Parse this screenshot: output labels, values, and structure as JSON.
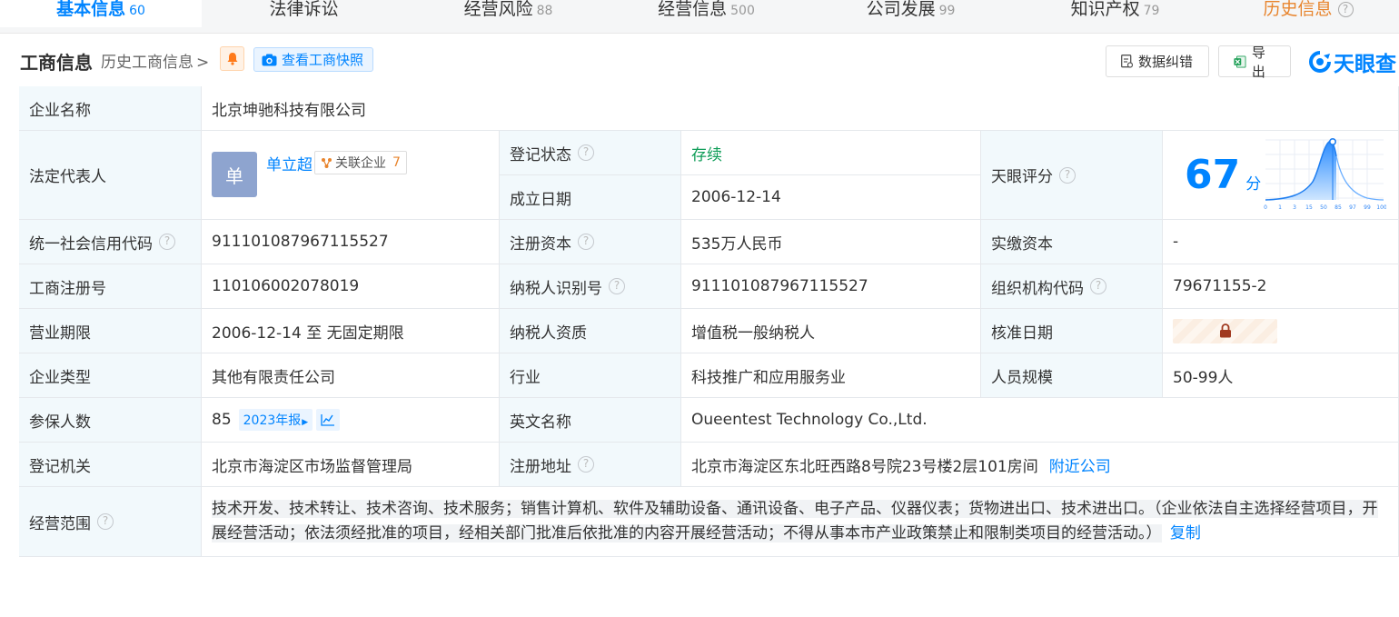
{
  "tabs": [
    {
      "label": "基本信息",
      "count": "60"
    },
    {
      "label": "法律诉讼",
      "count": ""
    },
    {
      "label": "经营风险",
      "count": "88"
    },
    {
      "label": "经营信息",
      "count": "500"
    },
    {
      "label": "公司发展",
      "count": "99"
    },
    {
      "label": "知识产权",
      "count": "79"
    },
    {
      "label": "历史信息",
      "count": ""
    }
  ],
  "header": {
    "title": "工商信息",
    "history_link": "历史工商信息",
    "snapshot_btn": "查看工商快照",
    "correct_btn": "数据纠错",
    "export_btn": "导出",
    "logo_text": "天眼查"
  },
  "rows": {
    "company_name": {
      "label": "企业名称",
      "value": "北京坤驰科技有限公司"
    },
    "legal_rep": {
      "label": "法定代表人",
      "avatar": "单",
      "name": "单立超",
      "related_label": "关联企业",
      "related_count": "7"
    },
    "reg_status": {
      "label": "登记状态",
      "value": "存续"
    },
    "found_date": {
      "label": "成立日期",
      "value": "2006-12-14"
    },
    "tianyan_score": {
      "label": "天眼评分",
      "value": "67",
      "unit": "分",
      "axis": [
        "0",
        "1",
        "3",
        "15",
        "50",
        "85",
        "97",
        "99",
        "100"
      ]
    },
    "credit_code": {
      "label": "统一社会信用代码",
      "value": "911101087967115527"
    },
    "reg_capital": {
      "label": "注册资本",
      "value": "535万人民币"
    },
    "paid_capital": {
      "label": "实缴资本",
      "value": "-"
    },
    "reg_no": {
      "label": "工商注册号",
      "value": "110106002078019"
    },
    "taxpayer_id": {
      "label": "纳税人识别号",
      "value": "911101087967115527"
    },
    "org_code": {
      "label": "组织机构代码",
      "value": "79671155-2"
    },
    "biz_term": {
      "label": "营业期限",
      "value": "2006-12-14 至 无固定期限"
    },
    "tax_quality": {
      "label": "纳税人资质",
      "value": "增值税一般纳税人"
    },
    "approve_date": {
      "label": "核准日期"
    },
    "company_type": {
      "label": "企业类型",
      "value": "其他有限责任公司"
    },
    "industry": {
      "label": "行业",
      "value": "科技推广和应用服务业"
    },
    "staff_size": {
      "label": "人员规模",
      "value": "50-99人"
    },
    "insured": {
      "label": "参保人数",
      "value": "85",
      "report": "2023年报"
    },
    "english_name": {
      "label": "英文名称",
      "value": "Oueentest Technology Co.,Ltd."
    },
    "reg_authority": {
      "label": "登记机关",
      "value": "北京市海淀区市场监督管理局"
    },
    "reg_address": {
      "label": "注册地址",
      "value": "北京市海淀区东北旺西路8号院23号楼2层101房间",
      "nearby": "附近公司"
    },
    "biz_scope": {
      "label": "经营范围",
      "value": "技术开发、技术转让、技术咨询、技术服务；销售计算机、软件及辅助设备、通讯设备、电子产品、仪器仪表；货物进出口、技术进出口。（企业依法自主选择经营项目，开展经营活动；依法须经批准的项目，经相关部门批准后依批准的内容开展经营活动；不得从事本市产业政策禁止和限制类项目的经营活动。）",
      "copy": "复制"
    }
  },
  "colors": {
    "accent": "#0084ff",
    "label_bg": "#f2f9fc",
    "status_green": "#0f9d58",
    "orange": "#e8852e"
  }
}
